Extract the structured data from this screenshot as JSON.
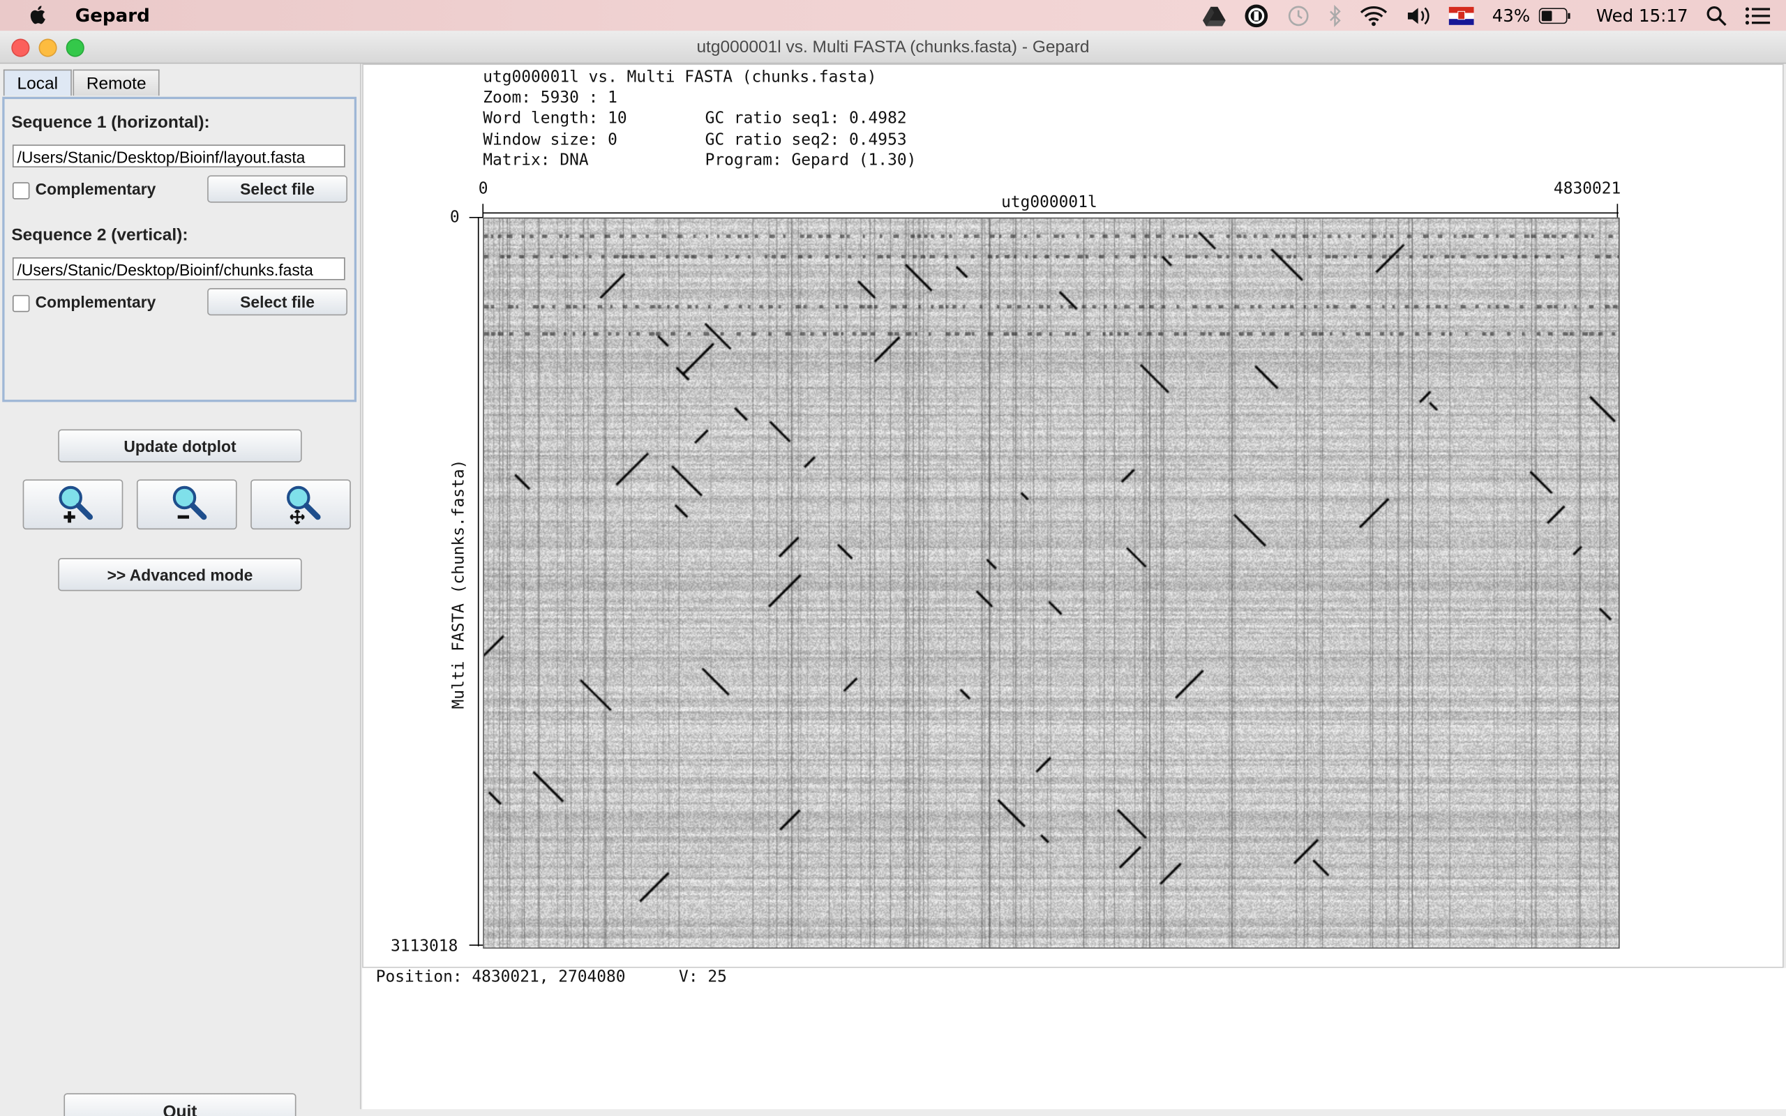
{
  "menubar": {
    "app_name": "Gepard",
    "battery_percent": "43%",
    "clock": "Wed 15:17"
  },
  "window": {
    "title": "utg000001l  vs.  Multi FASTA (chunks.fasta)  -  Gepard"
  },
  "left_panel": {
    "tabs": [
      {
        "label": "Local",
        "active": true
      },
      {
        "label": "Remote",
        "active": false
      }
    ],
    "seq1": {
      "label": "Sequence 1 (horizontal):",
      "path": "/Users/Stanic/Desktop/Bioinf/layout.fasta",
      "complementary_label": "Complementary",
      "complementary_checked": false,
      "select_label": "Select file"
    },
    "seq2": {
      "label": "Sequence 2 (vertical):",
      "path": "/Users/Stanic/Desktop/Bioinf/chunks.fasta",
      "complementary_label": "Complementary",
      "complementary_checked": false,
      "select_label": "Select file"
    },
    "update_label": "Update dotplot",
    "advanced_label": ">> Advanced mode",
    "quit_label": "Quit"
  },
  "plot": {
    "header": {
      "title": "utg000001l vs. Multi FASTA (chunks.fasta)",
      "zoom": "Zoom: 5930 : 1",
      "word_length": "Word length: 10",
      "window_size": "Window size: 0",
      "matrix": "Matrix: DNA",
      "gc1": "GC ratio seq1: 0.4982",
      "gc2": "GC ratio seq2: 0.4953",
      "program": "Program: Gepard (1.30)"
    },
    "x_start": "0",
    "x_end": "4830021",
    "x_label": "utg000001l",
    "y_start": "0",
    "y_end": "3113018",
    "y_label": "Multi FASTA (chunks.fasta)"
  },
  "status": {
    "position": "Position: 4830021, 2704080",
    "value": "V: 25"
  },
  "colors": {
    "accent": "#9fb7d6",
    "plot_background": "#c8c8c8",
    "close": "#fc605c",
    "minimize": "#fdbc40",
    "maximize": "#34c84a"
  }
}
